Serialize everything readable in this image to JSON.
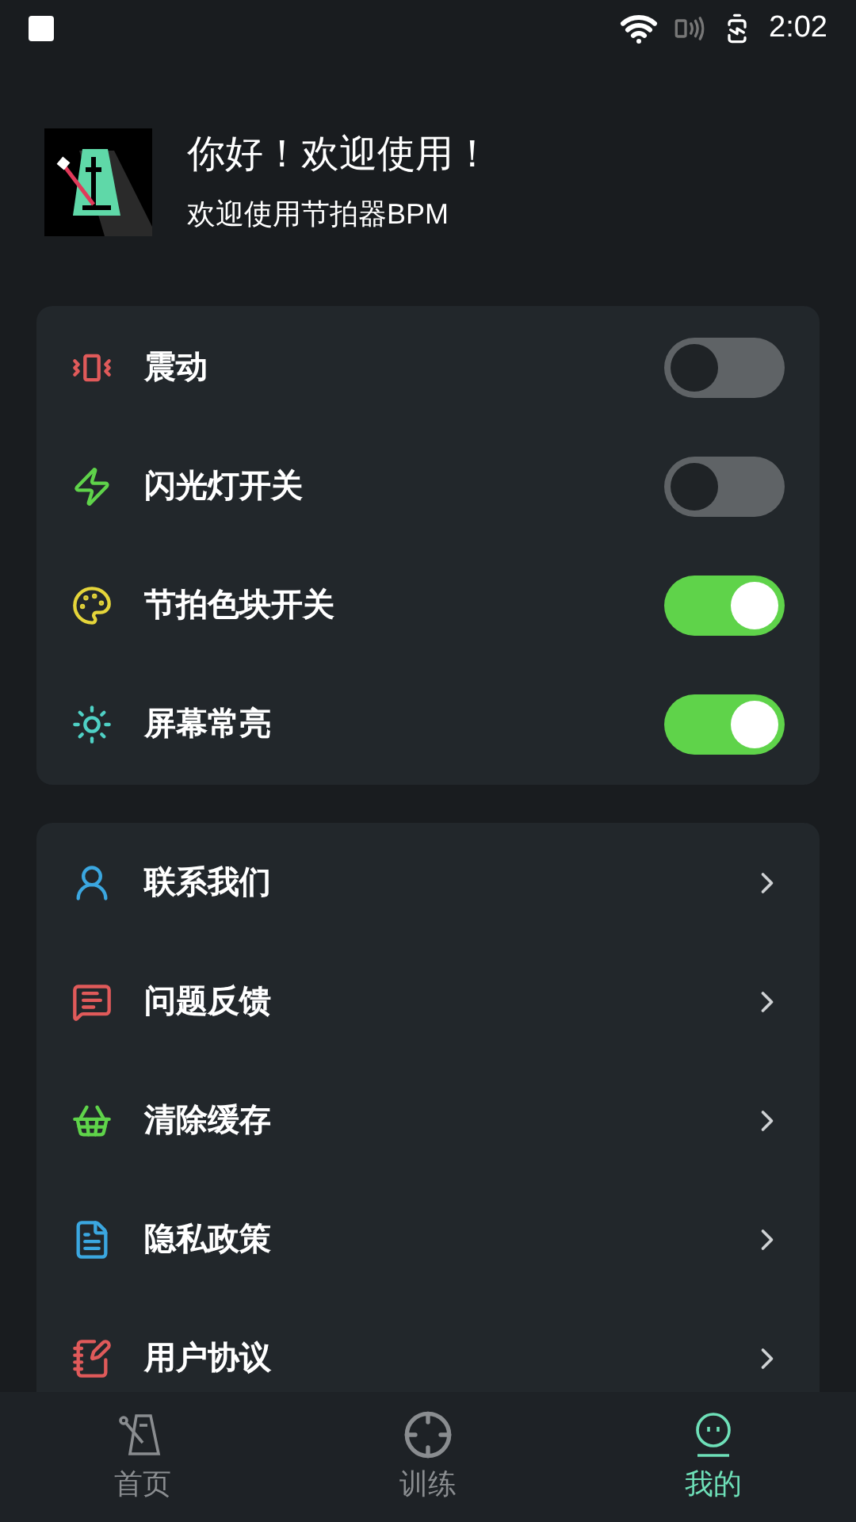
{
  "status_bar": {
    "time": "2:02"
  },
  "header": {
    "title": "你好！欢迎使用！",
    "subtitle": "欢迎使用节拍器BPM"
  },
  "settings": [
    {
      "label": "震动",
      "on": false,
      "color": "#e05a5a"
    },
    {
      "label": "闪光灯开关",
      "on": false,
      "color": "#5fd34a"
    },
    {
      "label": "节拍色块开关",
      "on": true,
      "color": "#e5d53a"
    },
    {
      "label": "屏幕常亮",
      "on": true,
      "color": "#4fd1c5"
    }
  ],
  "links": [
    {
      "label": "联系我们",
      "color": "#3ba7e0"
    },
    {
      "label": "问题反馈",
      "color": "#e05a5a"
    },
    {
      "label": "清除缓存",
      "color": "#5fd34a"
    },
    {
      "label": "隐私政策",
      "color": "#3ba7e0"
    },
    {
      "label": "用户协议",
      "color": "#e05a5a"
    }
  ],
  "tabs": [
    {
      "label": "首页",
      "selected": false
    },
    {
      "label": "训练",
      "selected": false
    },
    {
      "label": "我的",
      "selected": true
    }
  ]
}
